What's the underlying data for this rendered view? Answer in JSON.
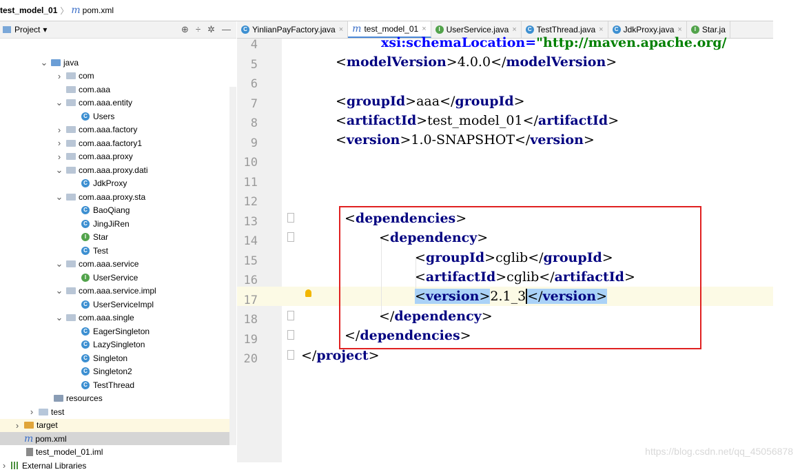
{
  "breadcrumb": {
    "project": "test_model_01",
    "file_icon": "m",
    "file": "pom.xml"
  },
  "project_panel": {
    "title": "Project",
    "tree": [
      {
        "label": "java",
        "indent": 74,
        "arrow": "down",
        "icon": "java-folder"
      },
      {
        "label": "com",
        "indent": 96,
        "arrow": "right",
        "icon": "package"
      },
      {
        "label": "com.aaa",
        "indent": 96,
        "arrow": "",
        "icon": "package"
      },
      {
        "label": "com.aaa.entity",
        "indent": 96,
        "arrow": "down",
        "icon": "package"
      },
      {
        "label": "Users",
        "indent": 118,
        "arrow": "",
        "icon": "class"
      },
      {
        "label": "com.aaa.factory",
        "indent": 96,
        "arrow": "right",
        "icon": "package"
      },
      {
        "label": "com.aaa.factory1",
        "indent": 96,
        "arrow": "right",
        "icon": "package"
      },
      {
        "label": "com.aaa.proxy",
        "indent": 96,
        "arrow": "right",
        "icon": "package"
      },
      {
        "label": "com.aaa.proxy.dati",
        "indent": 96,
        "arrow": "down",
        "icon": "package"
      },
      {
        "label": "JdkProxy",
        "indent": 118,
        "arrow": "",
        "icon": "class"
      },
      {
        "label": "com.aaa.proxy.sta",
        "indent": 96,
        "arrow": "down",
        "icon": "package"
      },
      {
        "label": "BaoQiang",
        "indent": 118,
        "arrow": "",
        "icon": "class"
      },
      {
        "label": "JingJiRen",
        "indent": 118,
        "arrow": "",
        "icon": "class"
      },
      {
        "label": "Star",
        "indent": 118,
        "arrow": "",
        "icon": "interface"
      },
      {
        "label": "Test",
        "indent": 118,
        "arrow": "",
        "icon": "class"
      },
      {
        "label": "com.aaa.service",
        "indent": 96,
        "arrow": "down",
        "icon": "package"
      },
      {
        "label": "UserService",
        "indent": 118,
        "arrow": "",
        "icon": "interface"
      },
      {
        "label": "com.aaa.service.impl",
        "indent": 96,
        "arrow": "down",
        "icon": "package"
      },
      {
        "label": "UserServiceImpl",
        "indent": 118,
        "arrow": "",
        "icon": "class"
      },
      {
        "label": "com.aaa.single",
        "indent": 96,
        "arrow": "down",
        "icon": "package"
      },
      {
        "label": "EagerSingleton",
        "indent": 118,
        "arrow": "",
        "icon": "class"
      },
      {
        "label": "LazySingleton",
        "indent": 118,
        "arrow": "",
        "icon": "class"
      },
      {
        "label": "Singleton",
        "indent": 118,
        "arrow": "",
        "icon": "class"
      },
      {
        "label": "Singleton2",
        "indent": 118,
        "arrow": "",
        "icon": "class"
      },
      {
        "label": "TestThread",
        "indent": 118,
        "arrow": "",
        "icon": "class"
      },
      {
        "label": "resources",
        "indent": 78,
        "arrow": "",
        "icon": "resources-folder"
      },
      {
        "label": "test",
        "indent": 56,
        "arrow": "right",
        "icon": "test-folder"
      },
      {
        "label": "target",
        "indent": 35,
        "arrow": "right",
        "icon": "target-folder",
        "hl": true
      },
      {
        "label": "pom.xml",
        "indent": 35,
        "arrow": "",
        "icon": "maven-file",
        "sel": true
      },
      {
        "label": "test_model_01.iml",
        "indent": 38,
        "arrow": "",
        "icon": "iml-file"
      },
      {
        "label": "External Libraries",
        "indent": 14,
        "arrow": "right",
        "icon": "libraries"
      }
    ]
  },
  "tabs": [
    {
      "label": "YinlianPayFactory.java",
      "icon": "c",
      "active": false
    },
    {
      "label": "test_model_01",
      "icon": "m",
      "active": true
    },
    {
      "label": "UserService.java",
      "icon": "i",
      "active": false
    },
    {
      "label": "TestThread.java",
      "icon": "c",
      "active": false
    },
    {
      "label": "JdkProxy.java",
      "icon": "c",
      "active": false
    },
    {
      "label": "Star.ja",
      "icon": "i",
      "active": false
    }
  ],
  "code": {
    "line_numbers": [
      "4",
      "5",
      "6",
      "7",
      "8",
      "9",
      "10",
      "11",
      "12",
      "13",
      "14",
      "15",
      "16",
      "17",
      "18",
      "19",
      "20"
    ],
    "line4_attr": "xsi:schemaLocation=",
    "line4_str": "\"http://maven.apache.org/",
    "modelVersion": "4.0.0",
    "groupId": "aaa",
    "artifactId": "test_model_01",
    "version": "1.0-SNAPSHOT",
    "dep_groupId": "cglib",
    "dep_artifactId": "cglib",
    "dep_version": "2.1_3"
  },
  "watermark": "https://blog.csdn.net/qq_45056878"
}
